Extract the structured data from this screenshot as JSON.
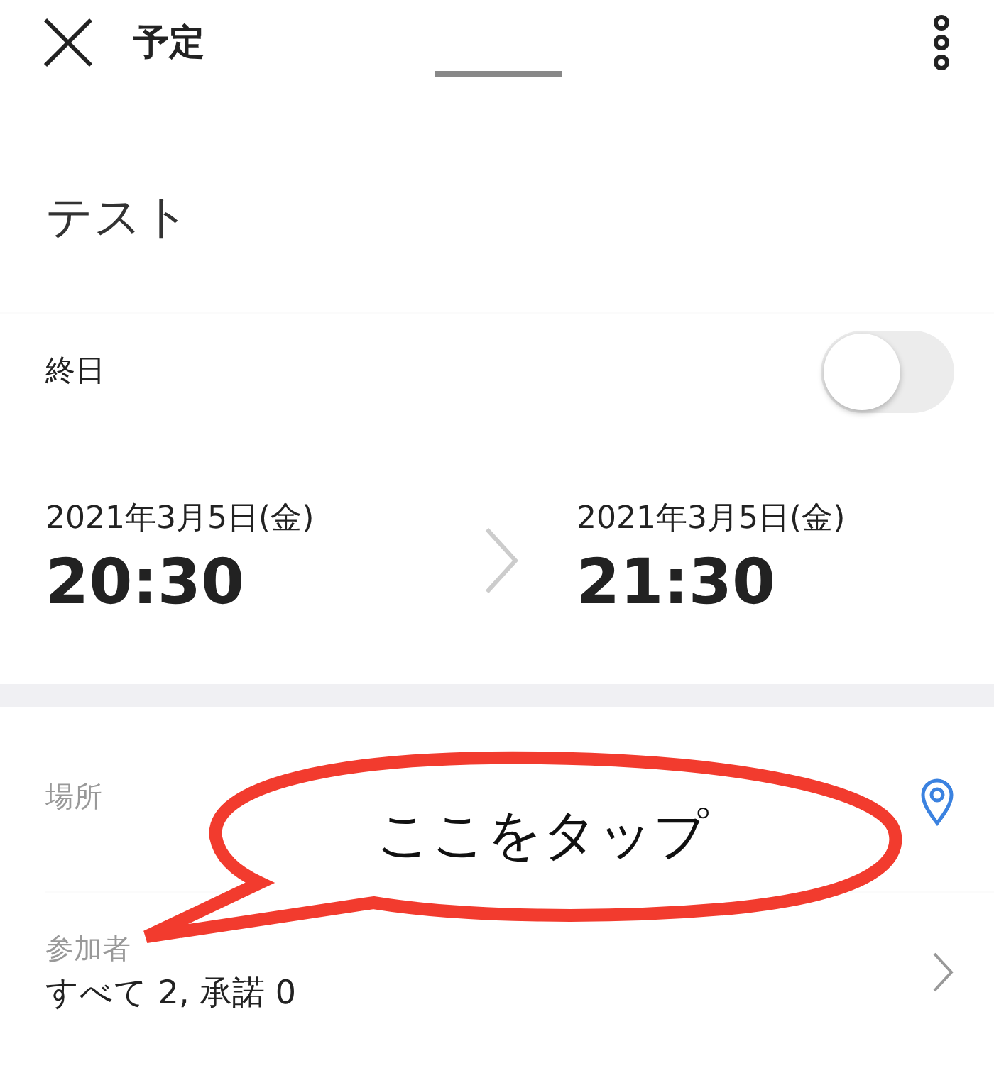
{
  "header": {
    "title": "予定"
  },
  "event_title": "テスト",
  "all_day": {
    "label": "終日",
    "on": false
  },
  "start": {
    "date": "2021年3月5日(金)",
    "time": "20:30"
  },
  "end": {
    "date": "2021年3月5日(金)",
    "time": "21:30"
  },
  "location": {
    "label": "場所"
  },
  "attendees": {
    "label": "参加者",
    "value": "すべて 2, 承諾 0"
  },
  "callout": {
    "text": "ここをタップ"
  }
}
